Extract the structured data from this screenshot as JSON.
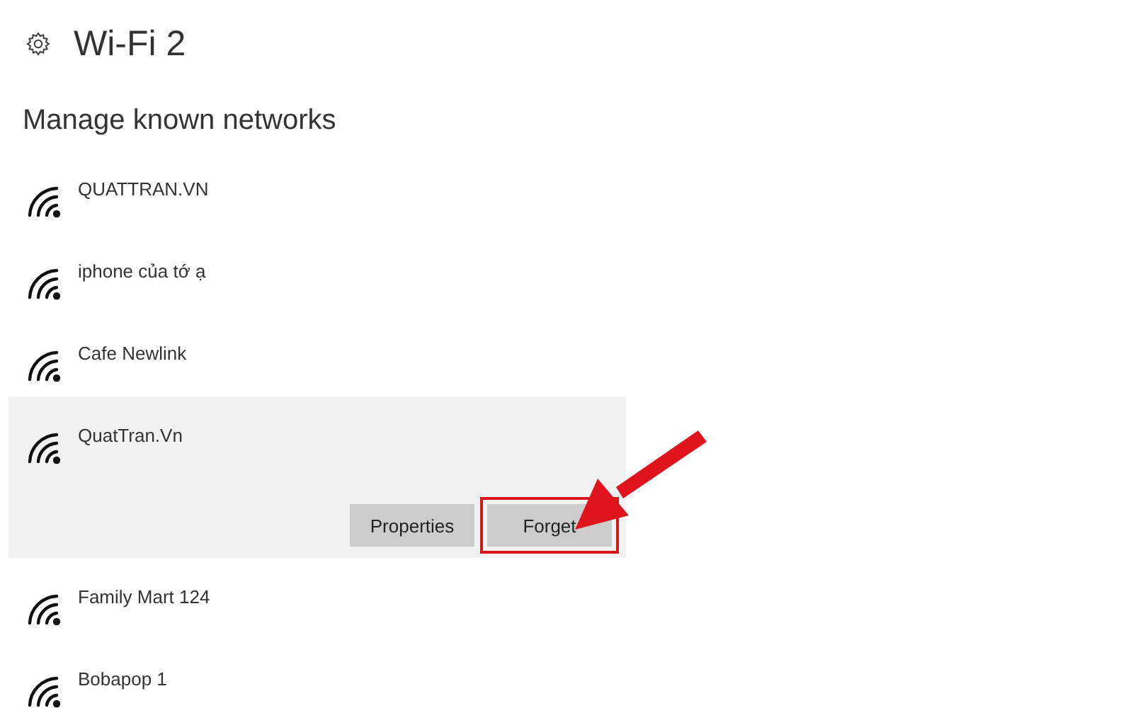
{
  "header": {
    "title": "Wi-Fi 2"
  },
  "section_title": "Manage known networks",
  "networks": [
    {
      "name": "QUATTRAN.VN",
      "selected": false
    },
    {
      "name": "iphone của tớ ạ",
      "selected": false
    },
    {
      "name": "Cafe Newlink",
      "selected": false
    },
    {
      "name": "QuatTran.Vn",
      "selected": true,
      "buttons": [
        {
          "label": "Properties",
          "annotated": false
        },
        {
          "label": "Forget",
          "annotated": true
        }
      ]
    },
    {
      "name": "Family Mart 124",
      "selected": false
    },
    {
      "name": "Bobapop 1",
      "selected": false
    }
  ]
}
